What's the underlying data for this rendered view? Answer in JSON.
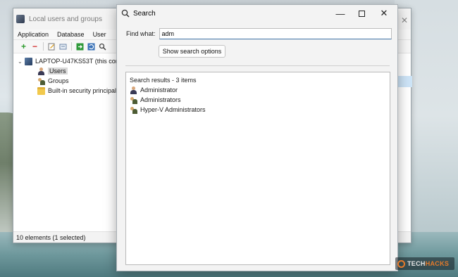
{
  "main_window": {
    "title": "Local users and groups",
    "menu": [
      "Application",
      "Database",
      "User"
    ],
    "toolbar_icons": [
      "add-icon",
      "remove-icon",
      "edit-icon",
      "properties-icon",
      "import-icon",
      "refresh-icon",
      "search-icon"
    ],
    "tree": {
      "root": "LAPTOP-U47KS53T (this comp",
      "children": [
        {
          "label": "Users",
          "icon": "user-icon",
          "selected": true
        },
        {
          "label": "Groups",
          "icon": "group-icon",
          "selected": false
        },
        {
          "label": "Built-in security principal",
          "icon": "folder-icon",
          "selected": false
        }
      ]
    },
    "status": "10 elements (1 selected)"
  },
  "search_dialog": {
    "title": "Search",
    "find_label": "Find what:",
    "find_value": "adm",
    "show_options_label": "Show search options",
    "results_header": "Search results - 3 items",
    "results": [
      {
        "label": "Administrator",
        "icon": "user-icon"
      },
      {
        "label": "Administrators",
        "icon": "group-icon"
      },
      {
        "label": "Hyper-V Administrators",
        "icon": "group-icon"
      }
    ]
  },
  "watermark": {
    "part1": "TECH",
    "part2": "HACKS"
  },
  "colors": {
    "accent": "#3a6ea5",
    "watermark_accent": "#e57a2a",
    "selection": "#d9d9d9"
  }
}
